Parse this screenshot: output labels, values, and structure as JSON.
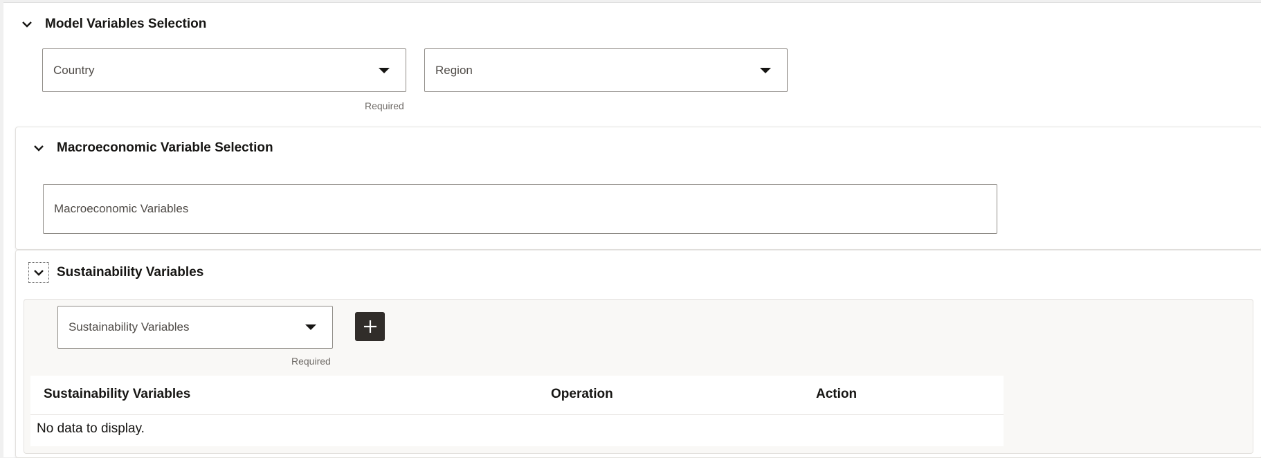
{
  "model_section": {
    "title": "Model Variables Selection",
    "country": {
      "value": "Country",
      "required": "Required"
    },
    "region": {
      "value": "Region"
    }
  },
  "macro_section": {
    "title": "Macroeconomic Variable Selection",
    "field": {
      "value": "Macroeconomic Variables"
    }
  },
  "sustainability_section": {
    "title": "Sustainability Variables",
    "select": {
      "value": "Sustainability Variables",
      "required": "Required"
    },
    "add_icon": "plus-icon",
    "table": {
      "columns": [
        "Sustainability Variables",
        "Operation",
        "Action"
      ],
      "empty_message": "No data to display."
    }
  },
  "colors": {
    "button_bg": "#312d2a",
    "panel_bg": "#f9f8f6",
    "border": "#8f8b86"
  }
}
